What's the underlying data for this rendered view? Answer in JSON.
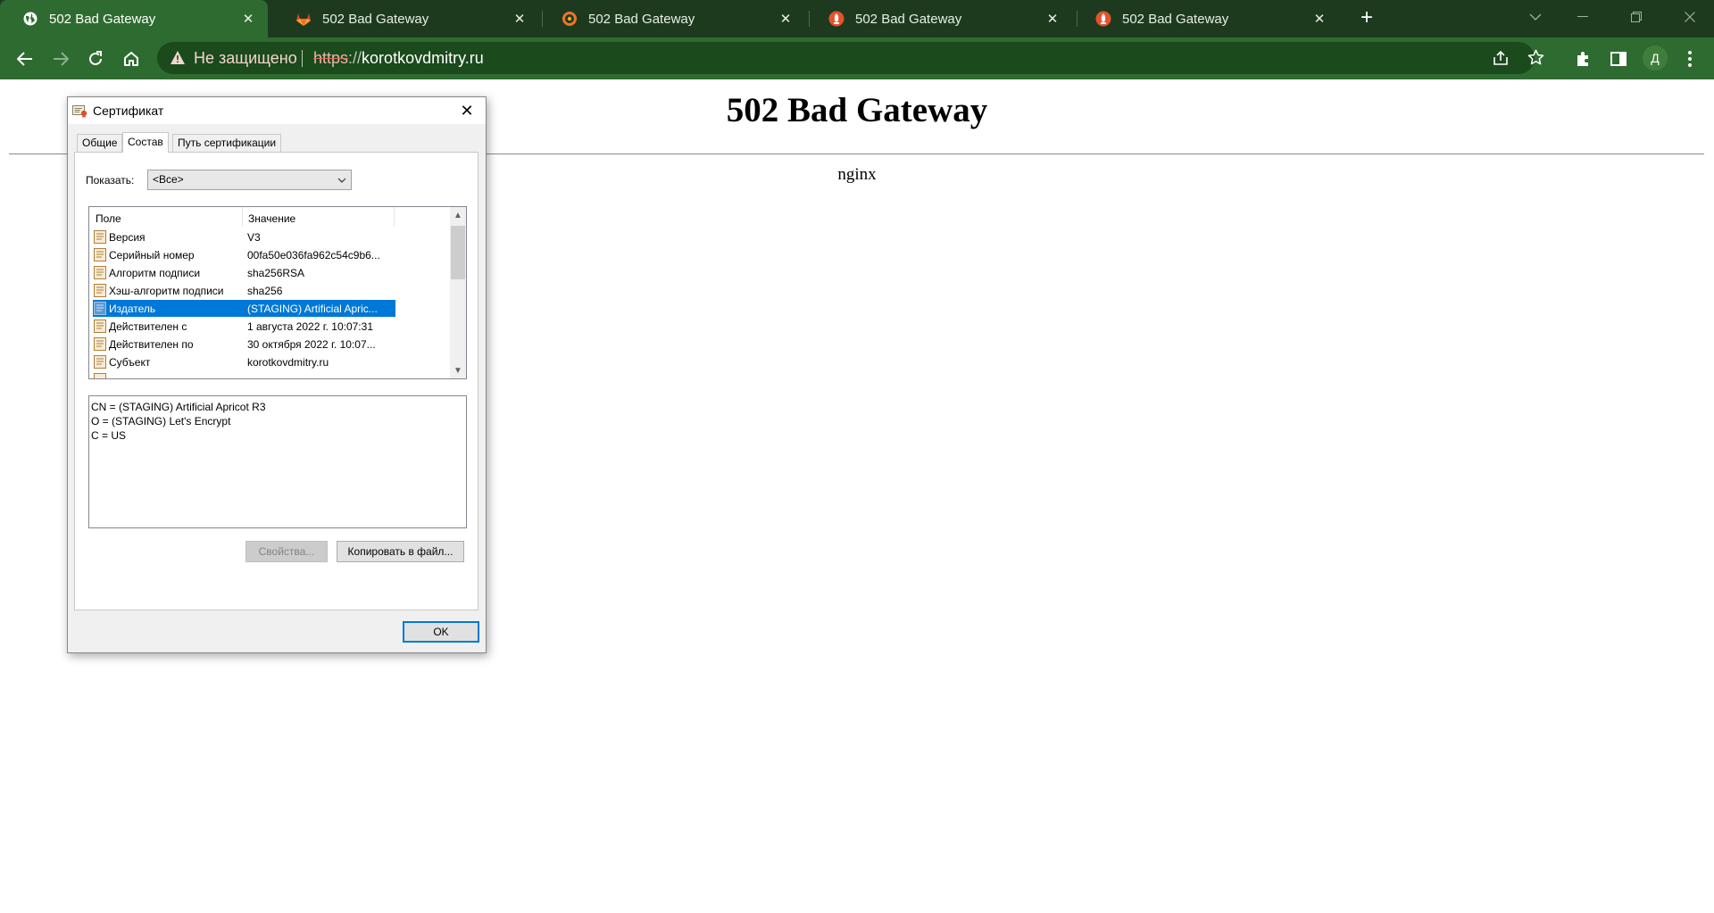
{
  "browser": {
    "tabs": [
      {
        "title": "502 Bad Gateway",
        "icon": "globe-icon",
        "active": true
      },
      {
        "title": "502 Bad Gateway",
        "icon": "gitlab-icon",
        "active": false
      },
      {
        "title": "502 Bad Gateway",
        "icon": "grafana-icon",
        "active": false
      },
      {
        "title": "502 Bad Gateway",
        "icon": "app-icon",
        "active": false
      },
      {
        "title": "502 Bad Gateway",
        "icon": "app-icon",
        "active": false
      }
    ],
    "new_tab": "+",
    "omnibox": {
      "security_label": "Не защищено",
      "url_scheme": "https",
      "url_sep": "://",
      "url_host": "korotkovdmitry.ru"
    },
    "profile_initial": "Д",
    "colors": {
      "frame": "#1d3a1f",
      "toolbar": "#2e6b30",
      "omnibox": "#1b4a1d"
    }
  },
  "page": {
    "heading": "502 Bad Gateway",
    "server": "nginx"
  },
  "dialog": {
    "title": "Сертификат",
    "tabs": [
      "Общие",
      "Состав",
      "Путь сертификации"
    ],
    "selected_tab": "Состав",
    "show_label": "Показать:",
    "show_value": "<Все>",
    "columns": {
      "field": "Поле",
      "value": "Значение"
    },
    "rows": [
      {
        "field": "Версия",
        "value": "V3"
      },
      {
        "field": "Серийный номер",
        "value": "00fa50e036fa962c54c9b6..."
      },
      {
        "field": "Алгоритм подписи",
        "value": "sha256RSA"
      },
      {
        "field": "Хэш-алгоритм подписи",
        "value": "sha256"
      },
      {
        "field": "Издатель",
        "value": "(STAGING) Artificial Apric...",
        "selected": true
      },
      {
        "field": "Действителен с",
        "value": "1 августа 2022 г. 10:07:31"
      },
      {
        "field": "Действителен по",
        "value": "30 октября 2022 г. 10:07..."
      },
      {
        "field": "Субъект",
        "value": "korotkovdmitry.ru"
      }
    ],
    "detail_lines": [
      "CN = (STAGING) Artificial Apricot R3",
      "O = (STAGING) Let's Encrypt",
      "C = US"
    ],
    "properties_button": "Свойства...",
    "copy_button": "Копировать в файл...",
    "ok_button": "OK",
    "colors": {
      "selection": "#0078d7"
    }
  }
}
